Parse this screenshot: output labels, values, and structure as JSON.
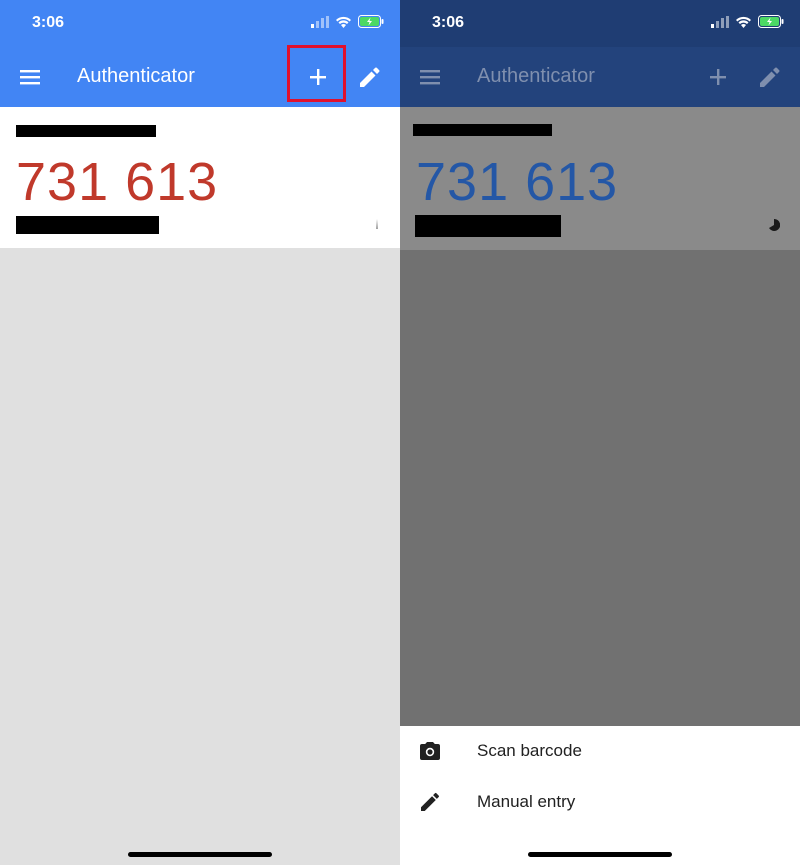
{
  "left": {
    "status": {
      "time": "3:06"
    },
    "app_bar": {
      "title": "Authenticator",
      "menu_icon": "menu-icon",
      "add_icon": "plus-icon",
      "edit_icon": "pencil-icon"
    },
    "entry": {
      "code": "731 613"
    },
    "highlight_color": "#e0102d"
  },
  "right": {
    "status": {
      "time": "3:06"
    },
    "app_bar": {
      "title": "Authenticator",
      "menu_icon": "menu-icon",
      "add_icon": "plus-icon",
      "edit_icon": "pencil-icon"
    },
    "entry": {
      "code": "731 613"
    },
    "sheet": {
      "items": [
        {
          "label": "Scan barcode",
          "icon": "camera-icon"
        },
        {
          "label": "Manual entry",
          "icon": "pencil-icon"
        }
      ]
    }
  },
  "colors": {
    "app_bar_blue": "#4285f4",
    "code_red": "#c0392b",
    "code_blue_dimmed": "#2457a6",
    "battery_green": "#4cd964"
  }
}
